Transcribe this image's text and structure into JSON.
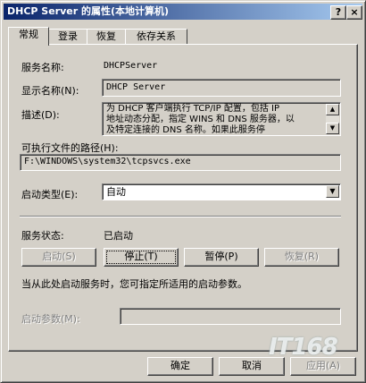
{
  "window": {
    "title": "DHCP Server 的属性(本地计算机)",
    "help_button": "?",
    "close_button": "×"
  },
  "tabs": [
    {
      "label": "常规",
      "active": true
    },
    {
      "label": "登录",
      "active": false
    },
    {
      "label": "恢复",
      "active": false
    },
    {
      "label": "依存关系",
      "active": false
    }
  ],
  "general": {
    "service_name_label": "服务名称:",
    "service_name_value": "DHCPServer",
    "display_name_label": "显示名称(N):",
    "display_name_value": "DHCP Server",
    "description_label": "描述(D):",
    "description_lines": [
      "为 DHCP 客户端执行 TCP/IP 配置，包括 IP",
      "地址动态分配，指定 WINS 和 DNS 服务器，以",
      "及特定连接的 DNS 名称。如果此服务停"
    ],
    "path_label": "可执行文件的路径(H):",
    "path_value": "F:\\WINDOWS\\system32\\tcpsvcs.exe",
    "startup_type_label": "启动类型(E):",
    "startup_type_value": "自动",
    "status_label": "服务状态:",
    "status_value": "已启动",
    "buttons": {
      "start": "启动(S)",
      "stop": "停止(T)",
      "pause": "暂停(P)",
      "resume": "恢复(R)"
    },
    "hint_text": "当从此处启动服务时，您可指定所适用的启动参数。",
    "start_params_label": "启动参数(M):",
    "start_params_value": ""
  },
  "footer": {
    "ok": "确定",
    "cancel": "取消",
    "apply": "应用(A)"
  },
  "watermark": "IT168"
}
